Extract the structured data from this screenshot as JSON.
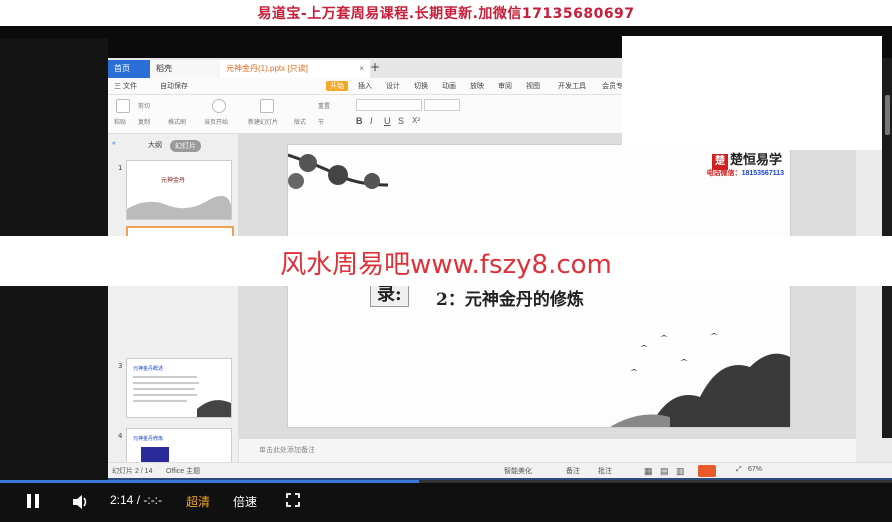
{
  "banner": {
    "text": "易道宝-上万套周易课程.长期更新.加微信17135680697",
    "color": "#c81e3a"
  },
  "watermark": {
    "text": "风水周易吧www.fszy8.com",
    "color": "#e0303a"
  },
  "app": {
    "tabs": {
      "home": "首页",
      "docer": "稻壳",
      "file": "元神金丹(1).pptx [只读]"
    },
    "menu": [
      "三 文件",
      "自动保存",
      "开始",
      "插入",
      "设计",
      "切换",
      "动画",
      "放映",
      "审阅",
      "视图",
      "开发工具",
      "会员专享"
    ],
    "ribbon": [
      "粘贴",
      "剪切",
      "复制",
      "格式刷",
      "当页开始",
      "新建幻灯片",
      "版式",
      "节",
      "重置"
    ],
    "panel_tabs": {
      "outline": "大纲",
      "slides": "幻灯片"
    },
    "thumbs": [
      {
        "num": "1",
        "text": "元神金丹"
      },
      {
        "num": "3",
        "text": "元神金丹概述"
      },
      {
        "num": "4",
        "text": "元神金丹修炼"
      }
    ],
    "slide": {
      "logo": "楚恒易学",
      "logo_mark": "楚",
      "phone_label": "电话微信：",
      "phone": "18153567113",
      "lu": "录:",
      "item2": "2：元神金丹的修炼"
    },
    "notes": "单击此处添加备注",
    "status": {
      "slide": "幻灯片 2 / 14",
      "theme": "Office 主题",
      "beautify": "智能美化",
      "notes": "备注",
      "comment": "批注",
      "zoom": "67%"
    }
  },
  "player": {
    "time": "2:14 / -:-:-",
    "quality": "超清",
    "speed": "倍速",
    "progress": 0.47
  }
}
